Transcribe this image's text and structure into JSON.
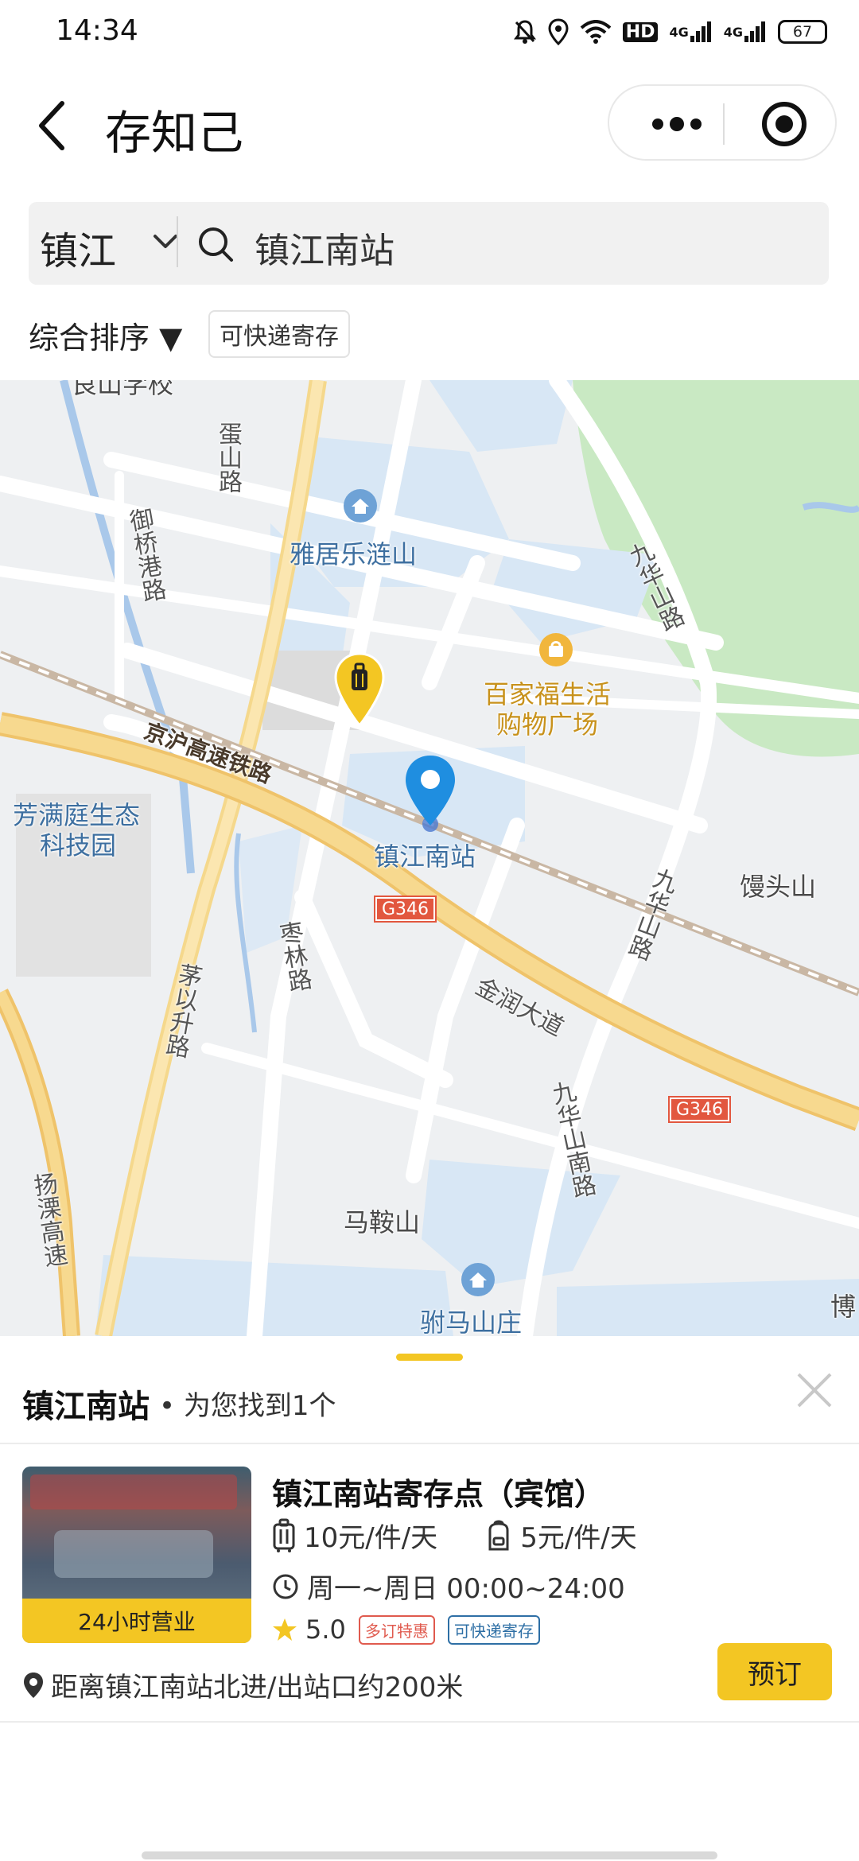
{
  "status_bar": {
    "time": "14:34",
    "hd": "HD",
    "net1": "4G",
    "net2": "4G",
    "battery": "67"
  },
  "header": {
    "title": "存知己"
  },
  "search": {
    "city": "镇江",
    "query": "镇江南站"
  },
  "filters": {
    "sort_label": "综合排序 ▼",
    "express_tag": "可快递寄存"
  },
  "map": {
    "pois": {
      "top_school": "良山学校",
      "road_danshan": "蛋山路",
      "road_yuqiao": "御桥港路",
      "yaju": "雅居乐涟山",
      "road_jiuhuashan": "九华山路",
      "baijiafu_1": "百家福生活",
      "baijiafu_2": "购物广场",
      "railway": "京沪高速铁路",
      "fangman_1": "芳满庭生态",
      "fangman_2": "科技园",
      "station": "镇江南站",
      "mantoushan": "馒头山",
      "road_jiuhuashan_2": "九华山路",
      "g346_a": "G346",
      "road_zaolin": "枣林路",
      "road_maoyisheng": "茅以升路",
      "jinrun": "金润大道",
      "g346_b": "G346",
      "road_jiuhuashan_nan": "九华山南路",
      "yangli": "扬溧高速",
      "maanshan": "马鞍山",
      "fumashan": "驸马山庄",
      "bo": "博"
    }
  },
  "sheet": {
    "title": "镇江南站",
    "subtitle": "• 为您找到1个"
  },
  "result": {
    "thumb_badge": "24小时营业",
    "name": "镇江南站寄存点（宾馆）",
    "price_large": "10元/件/天",
    "price_small": "5元/件/天",
    "hours": "周一~周日 00:00~24:00",
    "rating": "5.0",
    "tag_discount": "多订特惠",
    "tag_express": "可快递寄存",
    "distance": "距离镇江南站北进/出站口约200米",
    "book_label": "预订"
  },
  "colors": {
    "accent": "#f3c623",
    "map_bg": "#eef0f2",
    "road": "#ffffff",
    "highway": "#f7d98f",
    "water": "#d8e7f5",
    "park": "#c9e9c3",
    "pin_blue": "#1f8ee0"
  },
  "icons": [
    "back-icon",
    "more-dots-icon",
    "target-icon",
    "chevron-down-icon",
    "search-icon",
    "luggage-pin-icon",
    "location-pin-icon",
    "close-icon",
    "suitcase-icon",
    "backpack-icon",
    "clock-icon",
    "star-icon",
    "map-marker-icon"
  ]
}
